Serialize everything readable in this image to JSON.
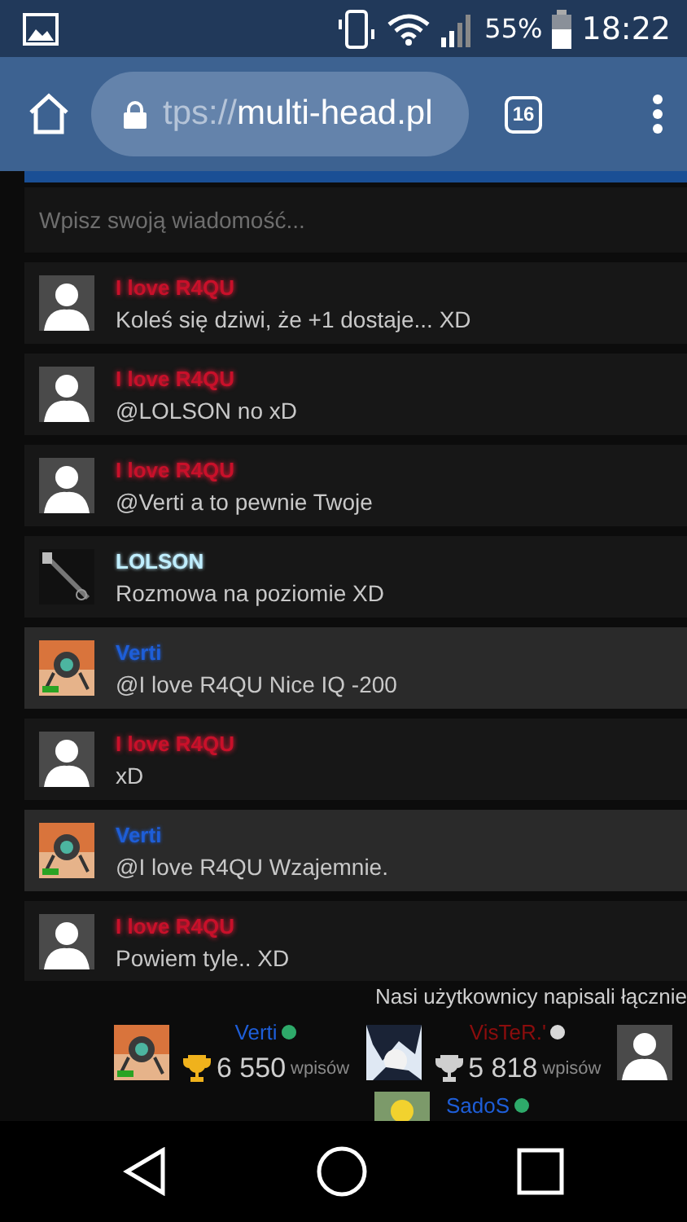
{
  "status_bar": {
    "battery": "55%",
    "time": "18:22"
  },
  "browser": {
    "url_scheme": "tps://",
    "url_host": "multi-head.pl",
    "tab_count": "16"
  },
  "chat": {
    "input": {
      "placeholder": "Wpisz swoją wiadomość..."
    },
    "messages": [
      {
        "author": "I love R4QU",
        "color": "#c8102a",
        "kind": "default",
        "text": "Koleś się dziwi, że +1 dostaje... XD",
        "own": false
      },
      {
        "author": "I love R4QU",
        "color": "#c8102a",
        "kind": "default",
        "text": "@LOLSON no xD",
        "own": false
      },
      {
        "author": "I love R4QU",
        "color": "#c8102a",
        "kind": "default",
        "text": "@Verti a to pewnie Twoje",
        "own": false
      },
      {
        "author": "LOLSON",
        "color": "#bfeeff",
        "kind": "picture",
        "text": "Rozmowa na poziomie XD",
        "own": false
      },
      {
        "author": "Verti",
        "color": "#1e5ed8",
        "kind": "picture",
        "text": "@I love R4QU Nice IQ -200",
        "own": true
      },
      {
        "author": "I love R4QU",
        "color": "#c8102a",
        "kind": "default",
        "text": "xD",
        "own": false
      },
      {
        "author": "Verti",
        "color": "#1e5ed8",
        "kind": "picture",
        "text": "@I love R4QU Wzajemnie.",
        "own": true
      },
      {
        "author": "I love R4QU",
        "color": "#c8102a",
        "kind": "default",
        "text": "Powiem tyle.. XD",
        "own": false
      }
    ]
  },
  "top_posters": {
    "heading": "Nasi użytkownicy napisali łącznie",
    "users": [
      {
        "kind": "full",
        "name": "Verti",
        "color": "#1e5ed8",
        "online": true,
        "trophy": {
          "color": "#f0b21c"
        },
        "count": "6 550",
        "unit": "wpisów"
      },
      {
        "kind": "full",
        "name": "VisTeR.'",
        "color": "#8b0d0d",
        "online": false,
        "trophy": {
          "color": "#cfcfcf"
        },
        "count": "5 818",
        "unit": "wpisów"
      },
      {
        "kind": "avatar"
      }
    ],
    "next_row": [
      {
        "name": "SadoS",
        "color": "#1e5ed8",
        "online": true
      }
    ]
  }
}
